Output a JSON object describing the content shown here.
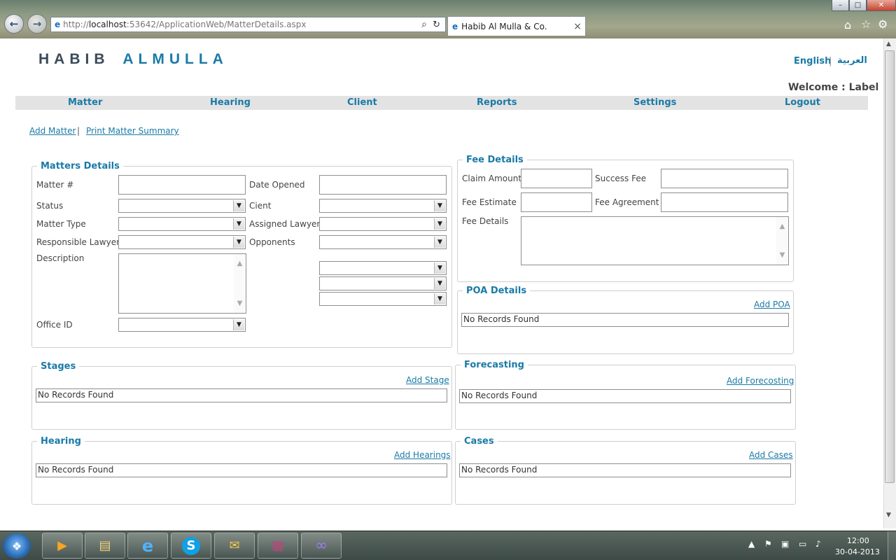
{
  "browser": {
    "url_prefix": "http://",
    "url_host": "localhost",
    "url_rest": ":53642/ApplicationWeb/MatterDetails.aspx",
    "tab_title": "Habib Al Mulla & Co.",
    "close_tab": "×",
    "back": "←",
    "forward": "→",
    "search_glyph": "⌕",
    "refresh_glyph": "↻",
    "home_glyph": "⌂",
    "star_glyph": "☆",
    "gear_glyph": "⚙",
    "min": "–",
    "max": "□",
    "close": "✕"
  },
  "header": {
    "logo_part1": "HABIB",
    "logo_part2": "ALMULLA",
    "logo_color1": "#3b4a58",
    "logo_color2": "#1a7aa7",
    "lang_en": "English",
    "lang_sep": "|",
    "lang_ar": "العربية",
    "welcome": "Welcome : Label"
  },
  "nav": [
    "Matter",
    "Hearing",
    "Client",
    "Reports",
    "Settings",
    "Logout"
  ],
  "actions": {
    "add_matter": "Add Matter",
    "sep": "|",
    "print_summary": "Print Matter Summary"
  },
  "matters": {
    "legend": "Matters Details",
    "matter_no": "Matter #",
    "date_opened": "Date Opened",
    "status": "Status",
    "client": "Cient",
    "matter_type": "Matter Type",
    "assigned_lawyer": "Assigned Lawyer",
    "responsible_lawyer": "Responsible Lawyer",
    "opponents": "Opponents",
    "description": "Description",
    "office_id": "Office ID",
    "dropdown_glyph": "▼",
    "scroll_up": "▲",
    "scroll_down": "▼"
  },
  "fee": {
    "legend": "Fee Details",
    "claim_amount": "Claim Amount",
    "success_fee": "Success Fee",
    "fee_estimate": "Fee Estimate",
    "fee_agreement": "Fee Agreement",
    "fee_details": "Fee Details"
  },
  "poa": {
    "legend": "POA Details",
    "add": "Add POA",
    "empty": "No Records Found"
  },
  "stages": {
    "legend": "Stages",
    "add": "Add Stage",
    "empty": "No Records Found"
  },
  "forecasting": {
    "legend": "Forecasting",
    "add": "Add Forecosting",
    "empty": "No Records Found"
  },
  "hearing": {
    "legend": "Hearing",
    "add": "Add Hearings",
    "empty": "No Records Found"
  },
  "cases": {
    "legend": "Cases",
    "add": "Add Cases",
    "empty": "No Records Found"
  },
  "taskbar": {
    "start_glyph": "❖",
    "time": "12:00",
    "date": "30-04-2013",
    "apps": [
      "media-player-icon",
      "file-explorer-icon",
      "internet-explorer-icon",
      "skype-icon",
      "outlook-icon",
      "winrar-icon",
      "visual-studio-icon"
    ],
    "app_glyphs": [
      "▶",
      "▤",
      "e",
      "S",
      "✉",
      "▦",
      "∞"
    ],
    "tray_glyphs": [
      "▲",
      "⚑",
      "▣",
      "▭",
      "♪"
    ]
  }
}
